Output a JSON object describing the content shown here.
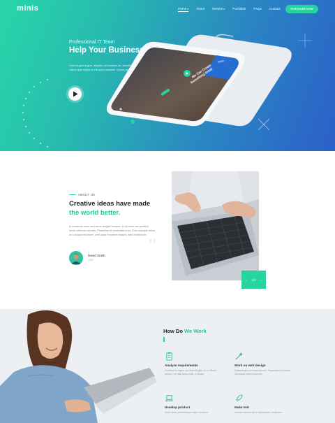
{
  "nav": {
    "logo": "minis",
    "links": [
      {
        "label": "Home",
        "caret": "▾"
      },
      {
        "label": "About",
        "caret": ""
      },
      {
        "label": "Service",
        "caret": "▾"
      },
      {
        "label": "Portfolios",
        "caret": ""
      },
      {
        "label": "FAQs",
        "caret": ""
      },
      {
        "label": "Contact",
        "caret": ""
      }
    ],
    "cta": "PURCHASE NOW"
  },
  "hero": {
    "subtitle": "Professional IT Team",
    "title": "Help Your Businesst Well",
    "description": "Diam augue augue, aliquam vel sodales ac, blandit et orci. In varius quis neque in elit porta molestie. Donec at ex nulla."
  },
  "about": {
    "kicker": "ABOUT US",
    "title_line1": "Creative ideas have made",
    "title_line2": "the world better.",
    "text": "In maximus risus sed lacus feugiat tempus. In sit amet est porttitor tortor vehicula lobortis. Phasellus et venenatis urna. Duis suscipit, tellus eu volutpat tincidunt, velit diam hendrerit mauris, sed vestibulum.",
    "quote_mark": "”",
    "author_name": "David Smith",
    "author_role": "CEO",
    "slider": {
      "prev": "←",
      "counter": "1/4",
      "next": "→"
    }
  },
  "work": {
    "title_plain": "How Do ",
    "title_accent": "We Work",
    "steps": [
      {
        "icon": "clipboard-icon",
        "title": "Analyze requirements",
        "text": "Curabitur id magna non diam fringilla, eu ut efficitur tempus, est felis luctus nulla, ut ornare."
      },
      {
        "icon": "magic-wand-icon",
        "title": "Work on web design",
        "text": "Pellentesque sed maximus orci. Suspendisse tincidunt consequat ipsum id laoreet."
      },
      {
        "icon": "laptop-icon",
        "title": "Develop product",
        "text": "Morbi varius pellentesque neque, tincidunt."
      },
      {
        "icon": "rocket-icon",
        "title": "Make test",
        "text": "Aenean sit amet libero ullamcorper, vestibulum."
      }
    ]
  },
  "colors": {
    "accent": "#27d4a0",
    "hero_start": "#29d6a8",
    "hero_end": "#2c5fc9"
  }
}
